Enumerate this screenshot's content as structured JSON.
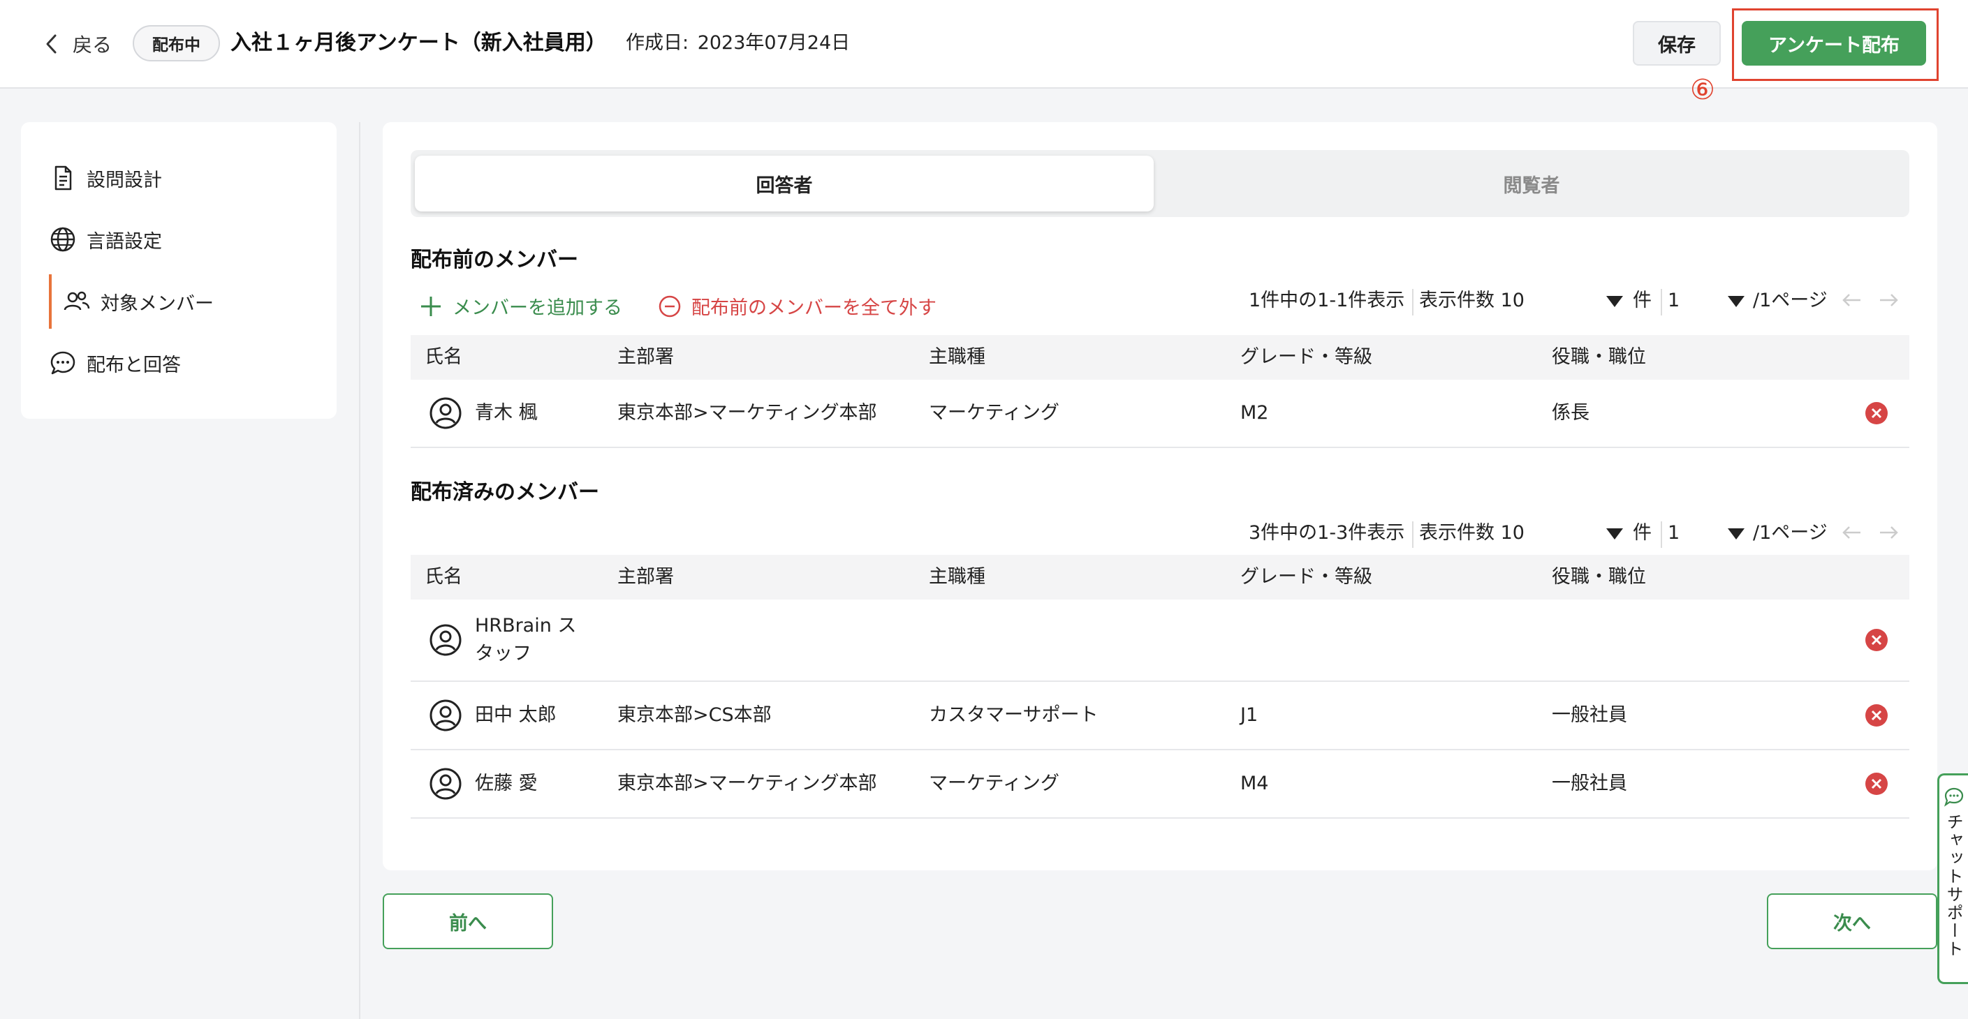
{
  "header": {
    "back_label": "戻る",
    "status_badge": "配布中",
    "title": "入社１ヶ月後アンケート（新入社員用）",
    "created_label": "作成日:",
    "created_date": "2023年07月24日",
    "save_label": "保存",
    "distribute_label": "アンケート配布",
    "marker": "⑥"
  },
  "sidebar": {
    "items": [
      {
        "label": "設問設計",
        "icon": "document-icon"
      },
      {
        "label": "言語設定",
        "icon": "globe-icon"
      },
      {
        "label": "対象メンバー",
        "icon": "users-icon",
        "active": true
      },
      {
        "label": "配布と回答",
        "icon": "chat-bubble-icon"
      }
    ]
  },
  "tabs": [
    {
      "label": "回答者",
      "active": true
    },
    {
      "label": "閲覧者",
      "active": false
    }
  ],
  "columns": [
    "氏名",
    "主部署",
    "主職種",
    "グレード・等級",
    "役職・職位"
  ],
  "pending": {
    "title": "配布前のメンバー",
    "add_label": "メンバーを追加する",
    "remove_all_label": "配布前のメンバーを全て外す",
    "pager": {
      "summary": "1件中の1-1件表示",
      "per_page": "表示件数 10",
      "unit": "件",
      "page": "1",
      "total": "/1ページ"
    },
    "rows": [
      {
        "name": "青木 楓",
        "dept": "東京本部>マーケティング本部",
        "job": "マーケティング",
        "grade": "M2",
        "position": "係長"
      }
    ]
  },
  "distributed": {
    "title": "配布済みのメンバー",
    "pager": {
      "summary": "3件中の1-3件表示",
      "per_page": "表示件数 10",
      "unit": "件",
      "page": "1",
      "total": "/1ページ"
    },
    "rows": [
      {
        "name": "HRBrain スタッフ",
        "dept": "",
        "job": "",
        "grade": "",
        "position": ""
      },
      {
        "name": "田中 太郎",
        "dept": "東京本部>CS本部",
        "job": "カスタマーサポート",
        "grade": "J1",
        "position": "一般社員"
      },
      {
        "name": "佐藤 愛",
        "dept": "東京本部>マーケティング本部",
        "job": "マーケティング",
        "grade": "M4",
        "position": "一般社員"
      }
    ]
  },
  "footer": {
    "prev_label": "前へ",
    "next_label": "次へ"
  },
  "chat_support": "チャットサポート",
  "colors": {
    "accent_green": "#45a05a",
    "danger_red": "#d64545",
    "highlight": "#e0432f",
    "active_bar": "#e8743b"
  }
}
